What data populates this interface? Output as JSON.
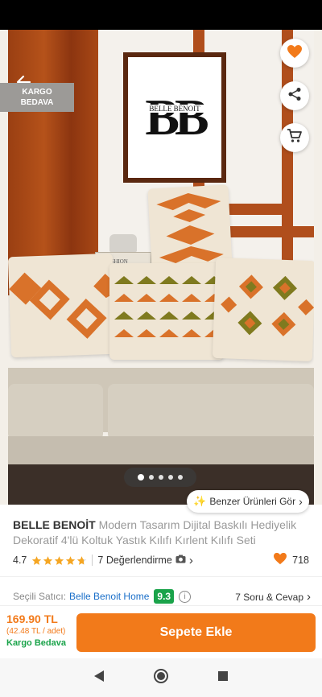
{
  "hero": {
    "cargo_badge_line1": "KARGO",
    "cargo_badge_line2": "BEDAVA",
    "similar_products_label": "Benzer Ürünleri Gör",
    "logo_letters": "BB",
    "logo_brand": "BELLE BENOIT",
    "book_text": "FASHION"
  },
  "product": {
    "brand": "BELLE BENOİT",
    "name": "Modern Tasarım Dijital Baskılı Hediyelik Dekoratif 4'lü Koltuk Yastık Kılıfı Kırlent Kılıfı Seti",
    "rating": "4.7",
    "star_fill": [
      1,
      1,
      1,
      1,
      0.7
    ],
    "reviews_label": "7 Değerlendirme",
    "favorites_count": "718"
  },
  "seller": {
    "label": "Seçili Satıcı:",
    "name": "Belle Benoit Home",
    "score": "9.3",
    "qa_label": "7 Soru & Cevap"
  },
  "bottom": {
    "price": "169.90 TL",
    "unit_price": "(42.48 TL / adet)",
    "free_shipping": "Kargo Bedava",
    "add_to_cart": "Sepete Ekle"
  },
  "colors": {
    "accent": "#f27a1a",
    "seller_link": "#1a6fc9",
    "score_green": "#1aa34a"
  },
  "icons": [
    "back-arrow-icon",
    "heart-icon",
    "share-icon",
    "cart-icon",
    "sparkle-icon",
    "chevron-right-icon",
    "camera-icon",
    "info-icon",
    "nav-back-icon",
    "nav-home-icon",
    "nav-recents-icon"
  ]
}
